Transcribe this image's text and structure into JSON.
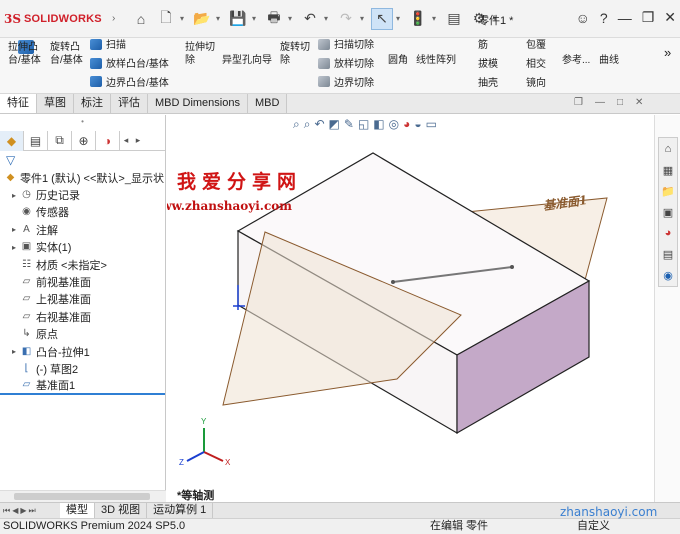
{
  "app": {
    "logo_ds": "3S",
    "logo_text": "SOLIDWORKS",
    "document_title": "零件1 *"
  },
  "toolbar": {
    "groups": {
      "extrude_boss": "拉伸凸\n台/基体",
      "revolve_boss": "旋转凸\n台/基体",
      "sweep": "扫描",
      "loft_boss": "放样凸台/基体",
      "boundary_boss": "边界凸台/基体",
      "extrude_cut": "拉伸切\n除",
      "hole_wizard": "异型孔向导",
      "revolve_cut": "旋转切\n除",
      "sweep_cut": "扫描切除",
      "loft_cut": "放样切除",
      "boundary_cut": "边界切除",
      "fillet": "圆角",
      "linear_pattern": "线性阵列",
      "rib": "筋",
      "draft": "拔模",
      "shell": "抽壳",
      "wrap": "包覆",
      "intersect": "相交",
      "mirror": "镜向",
      "ref_geometry": "参考...",
      "curves": "曲线"
    },
    "more": "»"
  },
  "tabs": [
    "特征",
    "草图",
    "标注",
    "评估",
    "MBD Dimensions",
    "MBD"
  ],
  "feature_tree": {
    "items": [
      {
        "label": "零件1 (默认) <<默认>_显示状",
        "icon": "part-icon",
        "expand": ""
      },
      {
        "label": "历史记录",
        "icon": "history-icon",
        "expand": "▸"
      },
      {
        "label": "传感器",
        "icon": "sensor-icon",
        "expand": ""
      },
      {
        "label": "注解",
        "icon": "annotation-icon",
        "expand": "▸"
      },
      {
        "label": "实体(1)",
        "icon": "solid-bodies-icon",
        "expand": "▸"
      },
      {
        "label": "材质 <未指定>",
        "icon": "material-icon",
        "expand": ""
      },
      {
        "label": "前视基准面",
        "icon": "plane-icon",
        "expand": ""
      },
      {
        "label": "上视基准面",
        "icon": "plane-icon",
        "expand": ""
      },
      {
        "label": "右视基准面",
        "icon": "plane-icon",
        "expand": ""
      },
      {
        "label": "原点",
        "icon": "origin-icon",
        "expand": ""
      },
      {
        "label": "凸台-拉伸1",
        "icon": "extrude-icon",
        "expand": "▸"
      },
      {
        "label": "(-) 草图2",
        "icon": "sketch-icon",
        "expand": ""
      },
      {
        "label": "基准面1",
        "icon": "plane-icon",
        "expand": ""
      }
    ]
  },
  "viewport": {
    "plane_label": "基准面1",
    "view_name": "*等轴测",
    "watermark_title": "我爱分享网",
    "watermark_url": "www.zhanshaoyi.com",
    "triad": {
      "x": "X",
      "y": "Y",
      "z": "Z"
    }
  },
  "bottom_tabs": [
    "模型",
    "3D 视图",
    "运动算例 1"
  ],
  "status": {
    "product": "SOLIDWORKS Premium 2024 SP5.0",
    "state": "在编辑 零件",
    "units": "自定义",
    "watermark": "zhanshaoyi.com"
  },
  "colors": {
    "brand": "#d0202a",
    "body_face_top": "#fdfbfb",
    "body_face_right": "#c2a8c6",
    "plane_edge": "#8a5a2e",
    "plane_fill": "#f3e6d8"
  }
}
